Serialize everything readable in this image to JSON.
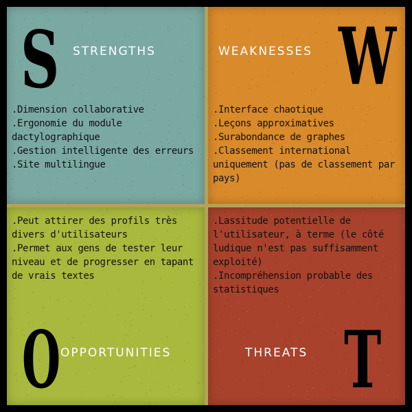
{
  "colors": {
    "strengths": "#7aa9a2",
    "weaknesses": "#d98a2a",
    "opportunities": "#a9b93d",
    "threats": "#a8422d",
    "border": "#b3a259"
  },
  "strengths": {
    "letter": "S",
    "title": "STRENGTHS",
    "items": [
      ".Dimension collaborative",
      ".Ergonomie du module dactylographique",
      ".Gestion intelligente des erreurs",
      ".Site multilingue"
    ]
  },
  "weaknesses": {
    "letter": "W",
    "title": "WEAKNESSES",
    "items": [
      ".Interface chaotique",
      ".Leçons approximatives",
      ".Surabondance de graphes",
      ".Classement international uniquement (pas de classement par pays)"
    ]
  },
  "opportunities": {
    "letter": "O",
    "title": "OPPORTUNITIES",
    "items": [
      ".Peut attirer des profils très divers d'utilisateurs",
      ".Permet aux gens de tester leur niveau et de progresser en tapant de vrais textes"
    ]
  },
  "threats": {
    "letter": "T",
    "title": "THREATS",
    "items": [
      ".Lassitude potentielle de l'utilisateur, à terme (le côté ludique n'est pas suffisamment exploité)",
      ".Incompréhension probable des statistiques"
    ]
  }
}
